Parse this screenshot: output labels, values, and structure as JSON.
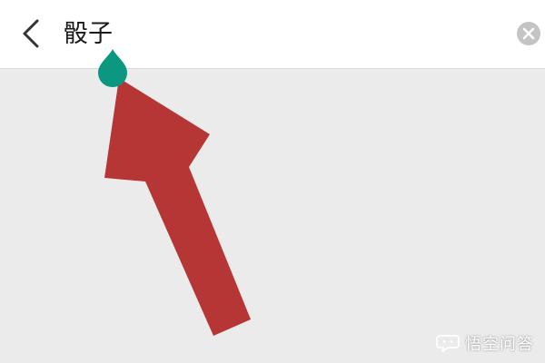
{
  "search_bar": {
    "back_icon": "chevron-left-icon",
    "query": "骰子",
    "clear_icon": "clear-x-circle-icon",
    "cursor_handle_color": "#0b9780"
  },
  "annotation": {
    "arrow_color": "#b63635",
    "pointing_to": "text-cursor-handle"
  },
  "watermark": {
    "logo_icon": "speech-bubble-icon",
    "text": "悟空问答"
  }
}
